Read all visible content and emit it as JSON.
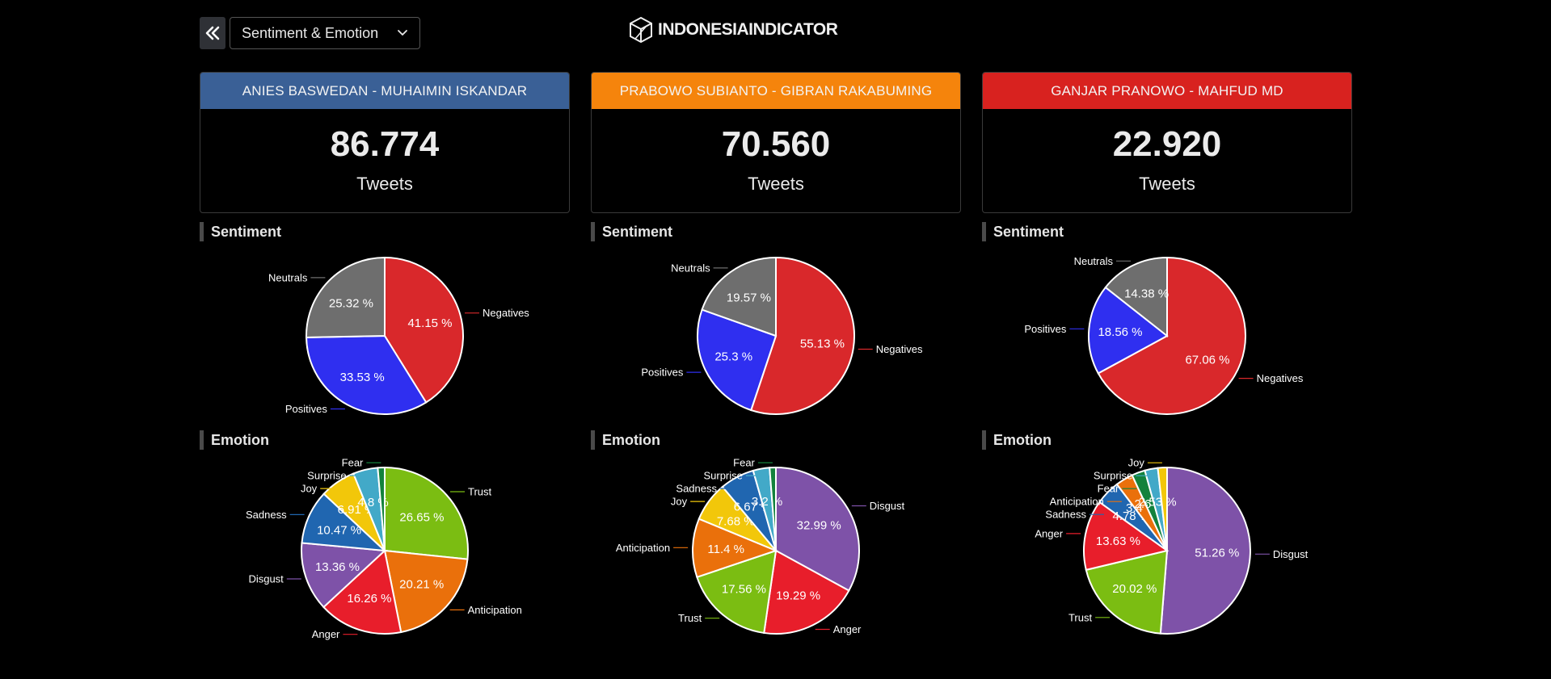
{
  "toolbar": {
    "dropdown_label": "Sentiment & Emotion",
    "logo_text": "INDONESIAINDICATOR"
  },
  "candidates": [
    {
      "name": "ANIES BASWEDAN - MUHAIMIN ISKANDAR",
      "count": "86.774",
      "unit": "Tweets",
      "color": "#3a6096"
    },
    {
      "name": "PRABOWO SUBIANTO - GIBRAN RAKABUMING",
      "count": "70.560",
      "unit": "Tweets",
      "color": "#f5840c"
    },
    {
      "name": "GANJAR PRANOWO - MAHFUD MD",
      "count": "22.920",
      "unit": "Tweets",
      "color": "#d8221f"
    }
  ],
  "sections": {
    "sentiment": "Sentiment",
    "emotion": "Emotion"
  },
  "colors": {
    "Negatives": "#d9282b",
    "Positives": "#2f2ff0",
    "Neutrals": "#6e6e6e",
    "Trust": "#7bbd12",
    "Anticipation": "#ea700b",
    "Anger": "#e81e2b",
    "Disgust": "#7e52a8",
    "Sadness": "#2066b0",
    "Joy": "#f2c70a",
    "Surprise": "#42a9c8",
    "Fear": "#13823c"
  },
  "chart_data": [
    {
      "type": "pie",
      "title": "Sentiment",
      "candidate": "ANIES BASWEDAN - MUHAIMIN ISKANDAR",
      "slices": [
        {
          "label": "Negatives",
          "value": 41.15
        },
        {
          "label": "Positives",
          "value": 33.53
        },
        {
          "label": "Neutrals",
          "value": 25.32
        }
      ]
    },
    {
      "type": "pie",
      "title": "Sentiment",
      "candidate": "PRABOWO SUBIANTO - GIBRAN RAKABUMING",
      "slices": [
        {
          "label": "Negatives",
          "value": 55.13
        },
        {
          "label": "Positives",
          "value": 25.3
        },
        {
          "label": "Neutrals",
          "value": 19.57
        }
      ]
    },
    {
      "type": "pie",
      "title": "Sentiment",
      "candidate": "GANJAR PRANOWO - MAHFUD MD",
      "slices": [
        {
          "label": "Negatives",
          "value": 67.06
        },
        {
          "label": "Positives",
          "value": 18.56
        },
        {
          "label": "Neutrals",
          "value": 14.38
        }
      ]
    },
    {
      "type": "pie",
      "title": "Emotion",
      "candidate": "ANIES BASWEDAN - MUHAIMIN ISKANDAR",
      "slices": [
        {
          "label": "Trust",
          "value": 26.65
        },
        {
          "label": "Anticipation",
          "value": 20.21
        },
        {
          "label": "Anger",
          "value": 16.26
        },
        {
          "label": "Disgust",
          "value": 13.36
        },
        {
          "label": "Sadness",
          "value": 10.47
        },
        {
          "label": "Joy",
          "value": 6.91
        },
        {
          "label": "Surprise",
          "value": 4.8
        },
        {
          "label": "Fear",
          "value": 1.34
        }
      ]
    },
    {
      "type": "pie",
      "title": "Emotion",
      "candidate": "PRABOWO SUBIANTO - GIBRAN RAKABUMING",
      "slices": [
        {
          "label": "Disgust",
          "value": 32.99
        },
        {
          "label": "Anger",
          "value": 19.29
        },
        {
          "label": "Trust",
          "value": 17.56
        },
        {
          "label": "Anticipation",
          "value": 11.4
        },
        {
          "label": "Joy",
          "value": 7.68
        },
        {
          "label": "Sadness",
          "value": 6.67
        },
        {
          "label": "Surprise",
          "value": 3.2
        },
        {
          "label": "Fear",
          "value": 1.21
        }
      ]
    },
    {
      "type": "pie",
      "title": "Emotion",
      "candidate": "GANJAR PRANOWO - MAHFUD MD",
      "slices": [
        {
          "label": "Disgust",
          "value": 51.26
        },
        {
          "label": "Trust",
          "value": 20.02
        },
        {
          "label": "Anger",
          "value": 13.63
        },
        {
          "label": "Sadness",
          "value": 4.78
        },
        {
          "label": "Anticipation",
          "value": 3.4
        },
        {
          "label": "Fear",
          "value": 2.6
        },
        {
          "label": "Surprise",
          "value": 2.53
        },
        {
          "label": "Joy",
          "value": 1.78
        }
      ]
    }
  ]
}
